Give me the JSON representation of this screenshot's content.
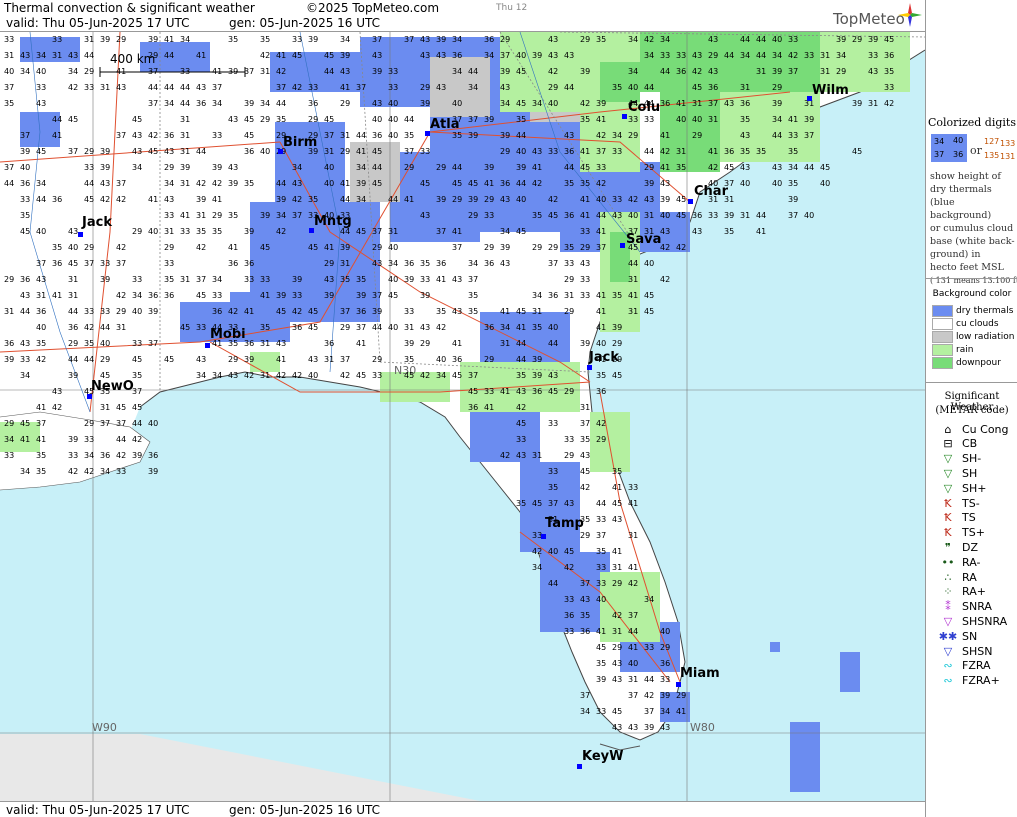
{
  "header": {
    "title": "Thermal convection & significant weather",
    "copyright": "©2025 TopMeteo.com",
    "day": "Thu 12",
    "valid": "valid:  Thu   05-Jun-2025  17 UTC",
    "gen": "gen: 05-Jun-2025 16 UTC",
    "logo": "TopMeteo"
  },
  "footer": {
    "valid": "valid:  Thu   05-Jun-2025  17 UTC",
    "gen": "gen: 05-Jun-2025 16 UTC"
  },
  "map": {
    "scale_label": "400 km",
    "coords": [
      "W90",
      "W80",
      "N30"
    ],
    "cities": [
      "Wilm",
      "Colu",
      "Atla",
      "Birm",
      "Char",
      "Mntg",
      "Sava",
      "Jack",
      "Mobi",
      "Jack",
      "NewO",
      "Tamp",
      "Miam",
      "KeyW"
    ]
  },
  "panel": {
    "colorized_title": "Colorized digits",
    "sample_blue": [
      "34",
      "40",
      "37",
      "36"
    ],
    "sample_or": "or",
    "sample_white": [
      "127",
      "133",
      "135",
      "131"
    ],
    "desc": [
      "show height of",
      "dry thermals",
      "(blue background)",
      "or cumulus cloud",
      "base (white back-",
      "ground) in",
      "hecto feet MSL",
      "( 131 means 13.100 ft)"
    ],
    "bg_title": "Background color",
    "bg_items": [
      {
        "label": "dry thermals",
        "color": "#6b8cf0"
      },
      {
        "label": "cu clouds",
        "color": "#ffffff"
      },
      {
        "label": "low radiation",
        "color": "#c8c8c8"
      },
      {
        "label": "rain",
        "color": "#b4f0a0"
      },
      {
        "label": "downpour",
        "color": "#78dc78"
      }
    ],
    "wx_title": "Significant Weather",
    "wx_subtitle": "(METAR code)",
    "wx_items": [
      {
        "label": "Cu Cong",
        "icon": "cu-cong-icon",
        "glyph": "⌂",
        "color": "#000"
      },
      {
        "label": "CB",
        "icon": "cb-icon",
        "glyph": "⊟",
        "color": "#000"
      },
      {
        "label": "SH-",
        "icon": "shower-light-icon",
        "glyph": "▽",
        "color": "#2a8a2a"
      },
      {
        "label": "SH",
        "icon": "shower-icon",
        "glyph": "▽",
        "color": "#2a8a2a"
      },
      {
        "label": "SH+",
        "icon": "shower-heavy-icon",
        "glyph": "▽",
        "color": "#2a8a2a"
      },
      {
        "label": "TS-",
        "icon": "thunderstorm-light-icon",
        "glyph": "Ꝁ",
        "color": "#c03020"
      },
      {
        "label": "TS",
        "icon": "thunderstorm-icon",
        "glyph": "Ꝁ",
        "color": "#c03020"
      },
      {
        "label": "TS+",
        "icon": "thunderstorm-heavy-icon",
        "glyph": "Ꝁ",
        "color": "#c03020"
      },
      {
        "label": "DZ",
        "icon": "drizzle-icon",
        "glyph": "❞",
        "color": "#1a5a1a"
      },
      {
        "label": "RA-",
        "icon": "rain-light-icon",
        "glyph": "••",
        "color": "#1a5a1a"
      },
      {
        "label": "RA",
        "icon": "rain-icon",
        "glyph": "∴",
        "color": "#1a5a1a"
      },
      {
        "label": "RA+",
        "icon": "rain-heavy-icon",
        "glyph": "⁘",
        "color": "#1a5a1a"
      },
      {
        "label": "SNRA",
        "icon": "snow-rain-icon",
        "glyph": "⁑",
        "color": "#b030d0"
      },
      {
        "label": "SHSNRA",
        "icon": "shower-snow-rain-icon",
        "glyph": "▽",
        "color": "#b030d0"
      },
      {
        "label": "SN",
        "icon": "snow-icon",
        "glyph": "✱✱",
        "color": "#3040d0"
      },
      {
        "label": "SHSN",
        "icon": "shower-snow-icon",
        "glyph": "▽",
        "color": "#3040d0"
      },
      {
        "label": "FZRA",
        "icon": "freezing-rain-icon",
        "glyph": "∾",
        "color": "#20c8d8"
      },
      {
        "label": "FZRA+",
        "icon": "freezing-rain-heavy-icon",
        "glyph": "∾",
        "color": "#20c8d8"
      }
    ]
  }
}
